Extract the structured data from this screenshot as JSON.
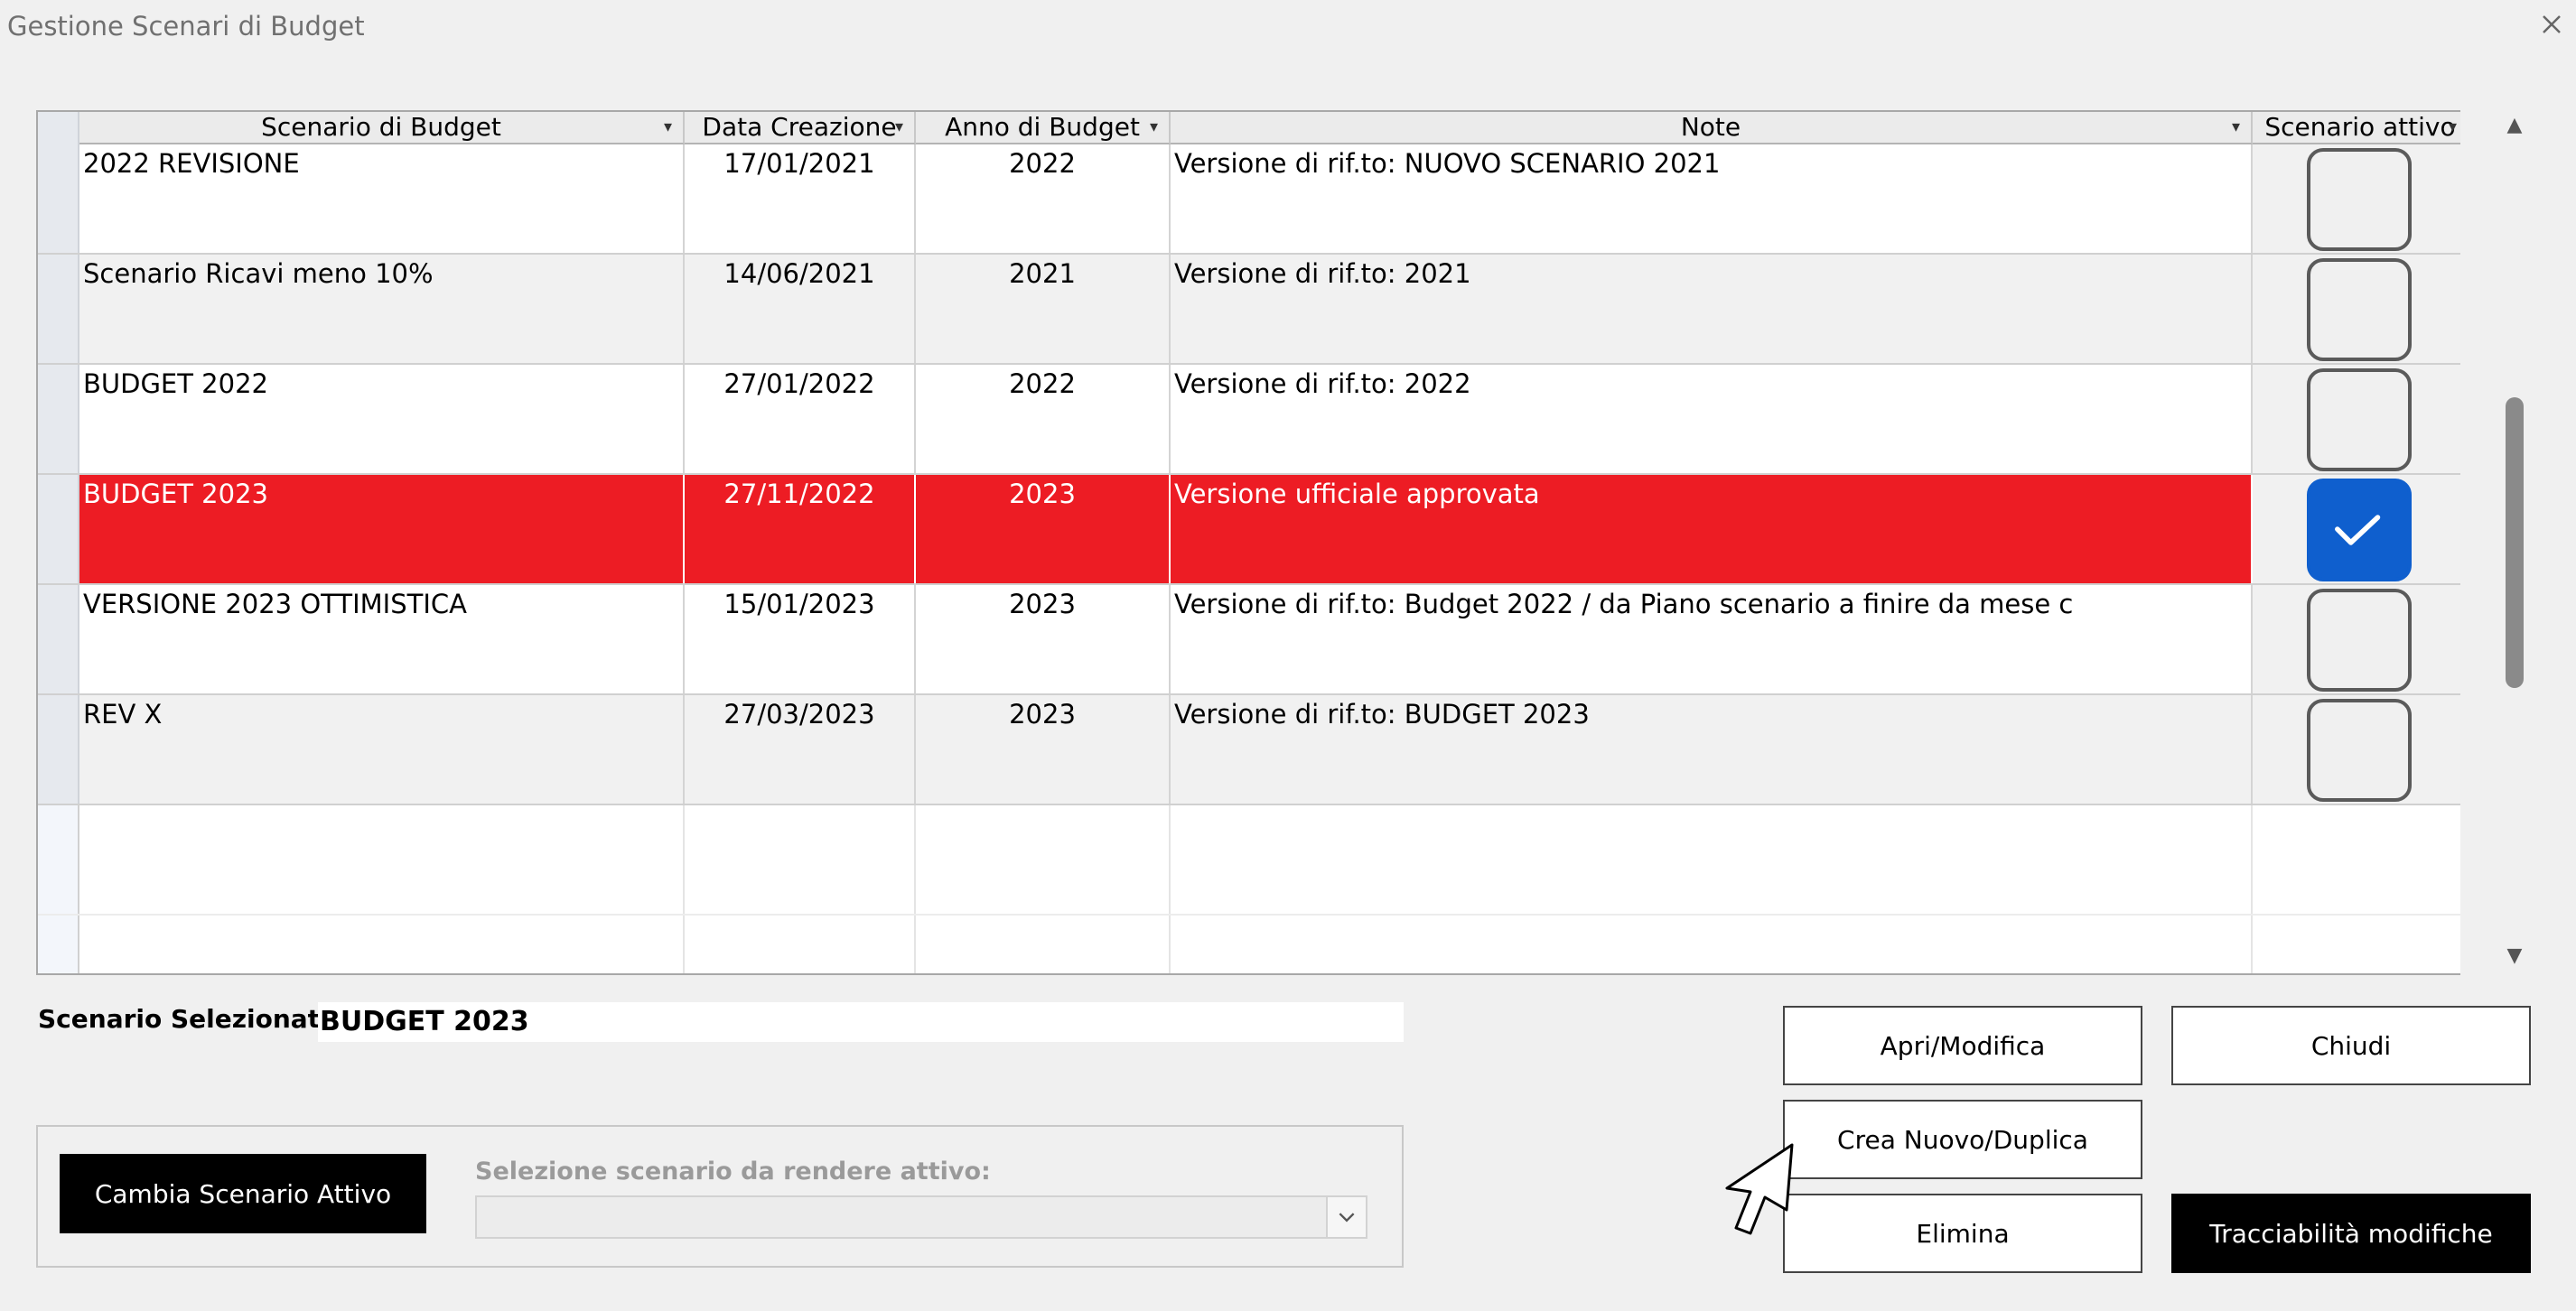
{
  "window": {
    "title": "Gestione Scenari di Budget"
  },
  "grid": {
    "columns": [
      "Scenario di Budget",
      "Data Creazione",
      "Anno di Budget",
      "Note",
      "Scenario attivo"
    ],
    "rows": [
      {
        "scenario": "2022 REVISIONE",
        "data": "17/01/2021",
        "anno": "2022",
        "note": "Versione di rif.to: NUOVO SCENARIO 2021",
        "attivo": false
      },
      {
        "scenario": "Scenario Ricavi meno 10%",
        "data": "14/06/2021",
        "anno": "2021",
        "note": "Versione di rif.to: 2021",
        "attivo": false
      },
      {
        "scenario": "BUDGET 2022",
        "data": "27/01/2022",
        "anno": "2022",
        "note": "Versione di rif.to: 2022",
        "attivo": false
      },
      {
        "scenario": "BUDGET 2023",
        "data": "27/11/2022",
        "anno": "2023",
        "note": "Versione ufficiale approvata",
        "attivo": true
      },
      {
        "scenario": "VERSIONE 2023 OTTIMISTICA",
        "data": "15/01/2023",
        "anno": "2023",
        "note": "Versione di rif.to: Budget 2022 / da Piano scenario a finire da mese c",
        "attivo": false
      },
      {
        "scenario": "REV X",
        "data": "27/03/2023",
        "anno": "2023",
        "note": "Versione di rif.to: BUDGET 2023",
        "attivo": false
      }
    ]
  },
  "selected": {
    "label": "Scenario Selezionato:",
    "value": "BUDGET 2023"
  },
  "change_active": {
    "button": "Cambia Scenario Attivo",
    "selection_label": "Selezione scenario da rendere attivo:",
    "selection_value": ""
  },
  "buttons": {
    "apri": "Apri/Modifica",
    "chiudi": "Chiudi",
    "crea": "Crea Nuovo/Duplica",
    "elimina": "Elimina",
    "tracciabilita": "Tracciabilità modifiche"
  },
  "colors": {
    "active_row": "#ed1c24",
    "checkbox_checked": "#0f5fce"
  }
}
